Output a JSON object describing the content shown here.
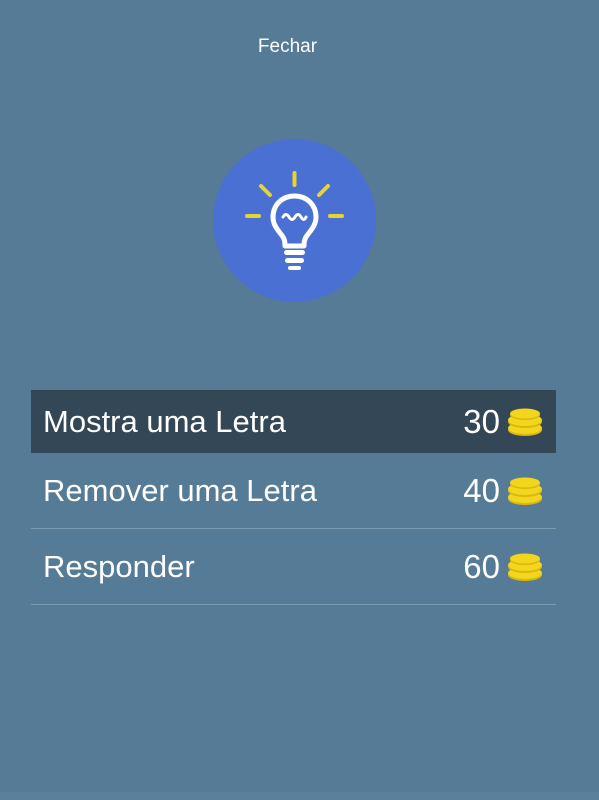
{
  "header": {
    "close_label": "Fechar"
  },
  "icon": {
    "name": "lightbulb-icon",
    "circle_color": "#4a70d4",
    "ray_color": "#e6d52a"
  },
  "options": [
    {
      "label": "Mostra uma Letra",
      "price": "30",
      "selected": true
    },
    {
      "label": "Remover uma Letra",
      "price": "40",
      "selected": false
    },
    {
      "label": "Responder",
      "price": "60",
      "selected": false
    }
  ],
  "colors": {
    "background": "#557b96",
    "selected_row": "#344757",
    "coin": "#f2d51c"
  }
}
